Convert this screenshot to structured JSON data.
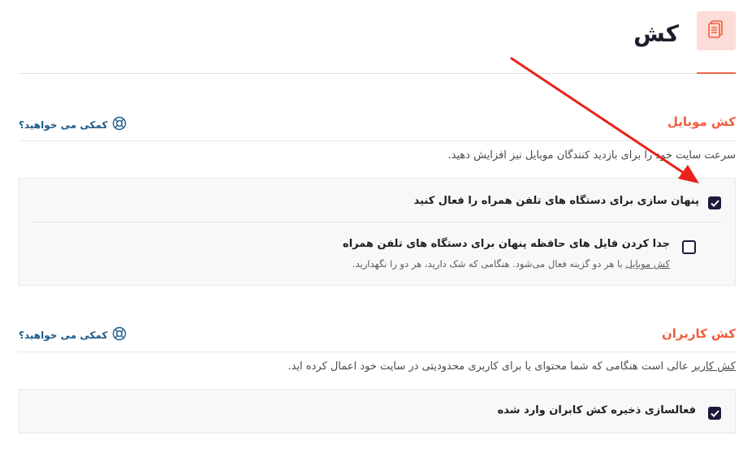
{
  "header": {
    "title": "کش",
    "icon": "document-icon",
    "accent": "#ef5d3c"
  },
  "sections": [
    {
      "title": "کش موبایل",
      "help_label": "کمکی می خواهید؟",
      "description": "سرعت سایت خود را برای بازدید کنندگان موبایل نیز افزایش دهید.",
      "options": [
        {
          "label": "پنهان سازی برای دستگاه های تلفن همراه را فعال کنید",
          "checked": true
        },
        {
          "label": "جدا کردن فایل های حافظه پنهان برای دستگاه های تلفن همراه",
          "checked": false,
          "desc_link": "کش موبایل",
          "desc_rest": " با هر دو گزینه فعال می‌شود. هنگامی که شک دارید، هر دو را نگهدارید."
        }
      ]
    },
    {
      "title": "کش کاربران",
      "help_label": "کمکی می خواهید؟",
      "desc_link": "کش کاربر",
      "desc_rest": " عالی است هنگامی که شما محتوای یا برای کاربری محدودیتی در سایت خود اعمال کرده اید.",
      "options": [
        {
          "label": "فعالسازی ذخیره کش کابران وارد شده",
          "checked": true
        }
      ]
    }
  ]
}
